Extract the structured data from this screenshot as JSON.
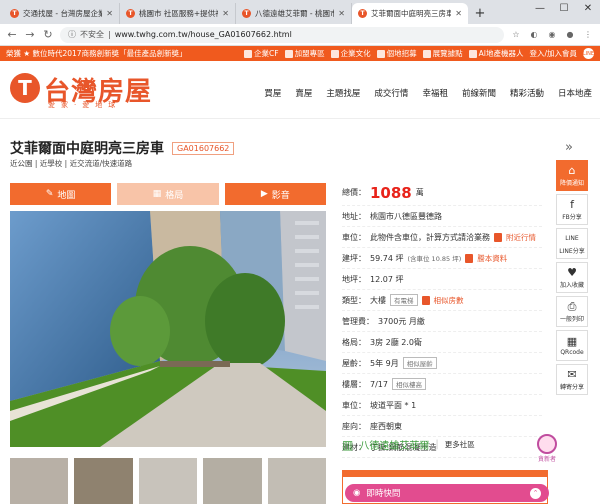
{
  "browser": {
    "tabs": [
      {
        "label": "交通找屋 - 台灣房屋企業",
        "active": false
      },
      {
        "label": "桃園市 社區服務+提供社",
        "active": false
      },
      {
        "label": "八德遠雄艾菲爾 - 桃園市",
        "active": false
      },
      {
        "label": "艾菲爾面中庭明亮三房車",
        "active": true
      }
    ],
    "new_tab": "+",
    "controls": {
      "minimize": "—",
      "maximize": "☐",
      "close": "✕"
    },
    "security": "不安全",
    "url": "www.twhg.com.tw/house_GA01607662.html"
  },
  "topbar": {
    "promo": "榮獲 ★ 數位時代2017商務創新獎「最佳產品創新獎」",
    "links": [
      "企業CF",
      "加盟專區",
      "企業文化",
      "個地招募",
      "展覽據點",
      "AI地產機器人",
      "登入/加入會員"
    ]
  },
  "logo": {
    "mark": "T",
    "name": "台灣房屋",
    "slogan": "愛家·愛地球"
  },
  "nav": [
    "買屋",
    "賣屋",
    "主題找屋",
    "成交行情",
    "幸福租",
    "前線新聞",
    "精彩活動",
    "日本地產"
  ],
  "listing": {
    "title": "艾菲爾面中庭明亮三房車",
    "code": "GA01607662",
    "tags": "近公園 | 近學校 | 近交流道/快速道路"
  },
  "media_tabs": [
    {
      "label": "地圖",
      "icon": "map-icon"
    },
    {
      "label": "格局",
      "icon": "floorplan-icon"
    },
    {
      "label": "影音",
      "icon": "video-icon"
    }
  ],
  "info": {
    "price_label": "總價：",
    "price": "1088",
    "price_unit": "萬",
    "address_label": "地址：",
    "address": "桃園市八德區豐德路",
    "parking_label": "車位：",
    "parking": "此物件含車位，計算方式請洽業務",
    "parking_link": "附近行情",
    "area_label": "建坪：",
    "area": "59.74 坪",
    "area_note": "(含車位 10.85 坪)",
    "area_link": "謄本資料",
    "land_label": "地坪：",
    "land": "12.07 坪",
    "type_label": "類型：",
    "type": "大樓",
    "type_pill": "有電梯",
    "type_link": "相似房數",
    "fee_label": "管理費：",
    "fee": "3700元 月繳",
    "layout_label": "格局：",
    "layout": "3房 2廳 2.0衛",
    "age_label": "屋齡：",
    "age": "5年 9月",
    "age_pill": "相似屋齡",
    "floor_label": "樓層：",
    "floor": "7/17",
    "floor_pill": "相似樓高",
    "car_label": "車位：",
    "car": "坡道平面 * 1",
    "facing_label": "座向：",
    "facing": "座西朝東",
    "material_label": "建材：",
    "material": "丁掛,鋼筋混凝土造"
  },
  "community": {
    "name": "八德遠雄艾菲爾",
    "more": "更多社區"
  },
  "side": [
    {
      "label": "降價通知",
      "glyph": "⌂"
    },
    {
      "label": "FB分享",
      "glyph": "f"
    },
    {
      "label": "LINE分享",
      "glyph": "LINE"
    },
    {
      "label": "加入收藏",
      "glyph": "♥"
    },
    {
      "label": "一般列印",
      "glyph": "⎙"
    },
    {
      "label": "QRcode",
      "glyph": "▦"
    },
    {
      "label": "轉寄分享",
      "glyph": "✉"
    }
  ],
  "chat": {
    "label": "即時快問",
    "chevron": "⌃"
  },
  "watermark": "貪新者"
}
